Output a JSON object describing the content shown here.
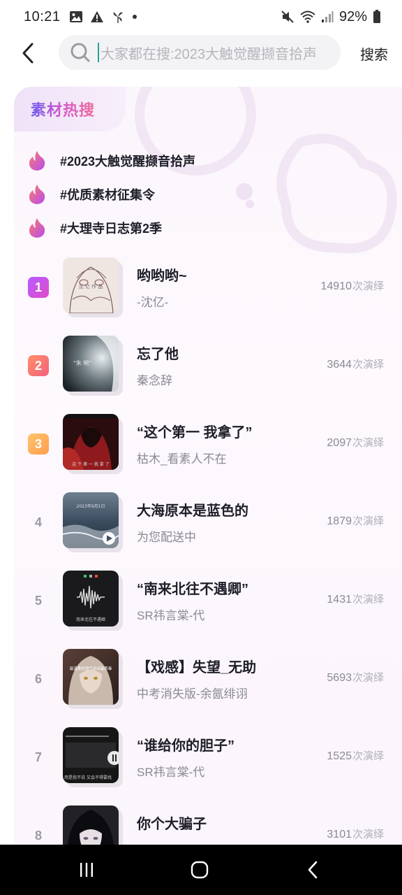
{
  "status_bar": {
    "time": "10:21",
    "battery": "92%",
    "left_icons": [
      "image-icon",
      "alert-icon",
      "pinwheel-icon",
      "dot-icon"
    ],
    "right_icons": [
      "mute-icon",
      "wifi-icon",
      "signal-icon",
      "battery-icon"
    ]
  },
  "header": {
    "search_placeholder": "大家都在搜:2023大触觉醒撷音拾声",
    "search_button": "搜索"
  },
  "card": {
    "title": "素材热搜",
    "hot_tags": [
      {
        "text": "#2023大触觉醒撷音拾声"
      },
      {
        "text": "#优质素材征集令"
      },
      {
        "text": "#大理寺日志第2季"
      }
    ],
    "count_unit": "次演绎",
    "items": [
      {
        "rank": "1",
        "title": "哟哟哟~",
        "author": "-沈亿-",
        "count": "14910"
      },
      {
        "rank": "2",
        "title": "忘了他",
        "author": "秦念辞",
        "count": "3644"
      },
      {
        "rank": "3",
        "title": "“这个第一  我拿了”",
        "author": "枯木_看素人不在",
        "count": "2097"
      },
      {
        "rank": "4",
        "title": "大海原本是蓝色的",
        "author": "为您配送中",
        "count": "1879"
      },
      {
        "rank": "5",
        "title": "“南来北往不遇卿”",
        "author": "SR祎言棠-代",
        "count": "1431"
      },
      {
        "rank": "6",
        "title": "【戏感】失望_无助",
        "author": "中考消失版-余氤绯诩",
        "count": "5693"
      },
      {
        "rank": "7",
        "title": "“谁给你的胆子”",
        "author": "SR祎言棠-代",
        "count": "1525"
      },
      {
        "rank": "8",
        "title": "你个大骗子",
        "author": "",
        "count": "3101"
      }
    ]
  },
  "thumb_texts": {
    "t1": "沈 亿 作 品",
    "t2": "\"朱 啊\"",
    "t3": "这 个 第 一 我 拿 了",
    "t4": "2023年6月1日",
    "t5": "南来北往不遇卿",
    "t6": "最温柔的语气说出最恶毒",
    "t7": "用是我不说 又会不得要找"
  },
  "colors": {
    "accent_gradient": [
      "#6a5cf0",
      "#d85ac8",
      "#f06a9a"
    ],
    "rank1": "#c257f0",
    "rank2": "#f67470",
    "rank3": "#ffb15c"
  },
  "nav": {
    "buttons": [
      "recents-icon",
      "home-icon",
      "back-icon"
    ]
  }
}
